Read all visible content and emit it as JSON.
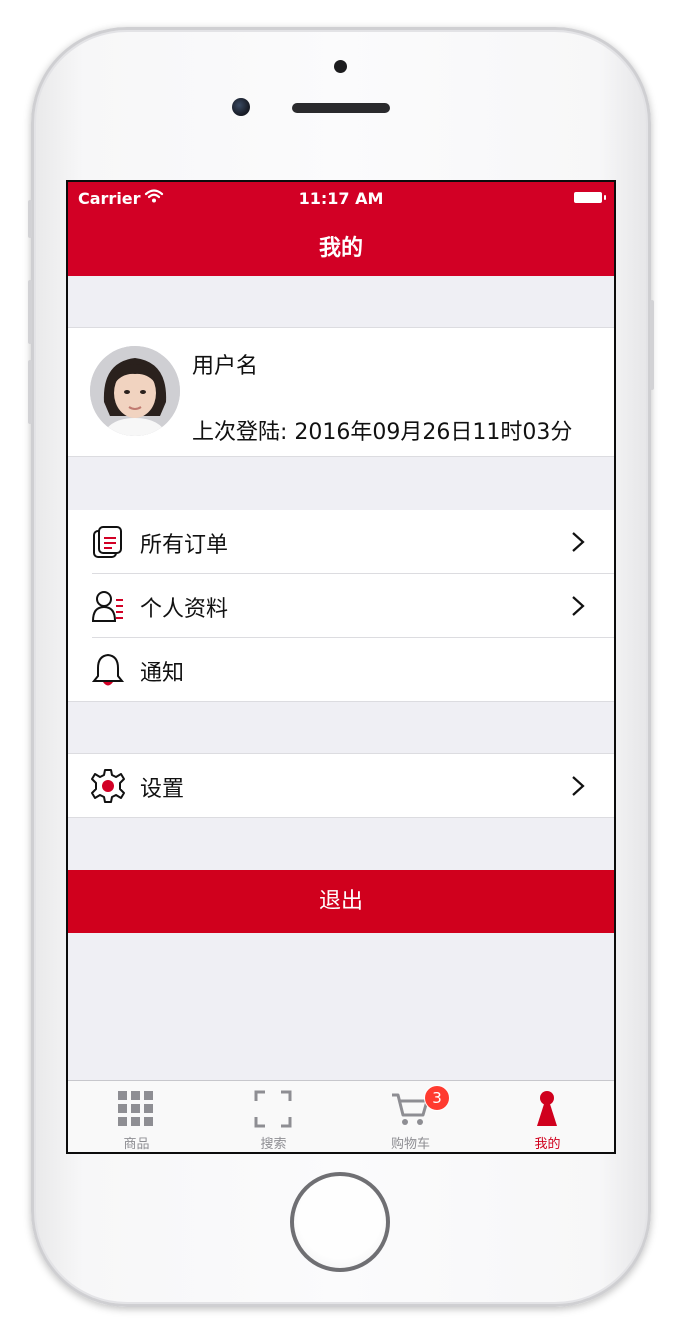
{
  "status_bar": {
    "carrier": "Carrier",
    "time": "11:17 AM"
  },
  "nav": {
    "title": "我的"
  },
  "profile": {
    "username": "用户名",
    "last_login": "上次登陆: 2016年09月26日11时03分"
  },
  "menu": {
    "orders": {
      "label": "所有订单",
      "icon": "orders-icon"
    },
    "personal": {
      "label": "个人资料",
      "icon": "profile-icon"
    },
    "notifications": {
      "label": "通知",
      "icon": "bell-icon"
    },
    "settings": {
      "label": "设置",
      "icon": "gear-icon"
    }
  },
  "logout": {
    "label": "退出"
  },
  "tabbar": {
    "tabs": [
      {
        "label": "商品",
        "icon": "grid-icon"
      },
      {
        "label": "搜索",
        "icon": "scan-frame-icon"
      },
      {
        "label": "购物车",
        "icon": "cart-icon",
        "badge": "3"
      },
      {
        "label": "我的",
        "icon": "user-icon"
      }
    ],
    "active_index": 3
  },
  "colors": {
    "brand_red": "#d20025",
    "background": "#efeff4",
    "badge_red": "#ff3b30",
    "inactive_tab": "#8e8e93"
  }
}
